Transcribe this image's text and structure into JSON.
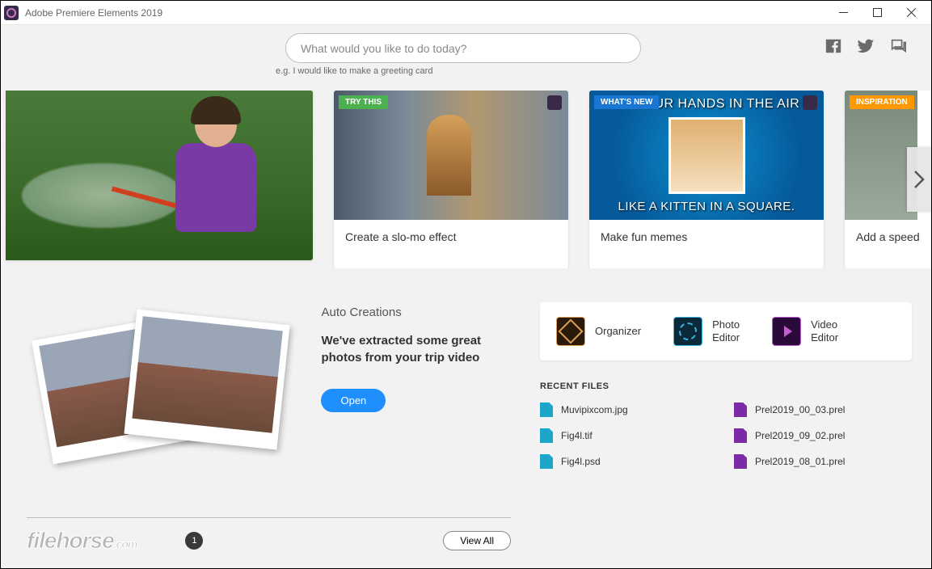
{
  "titlebar": {
    "title": "Adobe Premiere Elements 2019"
  },
  "search": {
    "placeholder": "What would you like to do today?",
    "example": "e.g. I would like to make a greeting card"
  },
  "carousel": {
    "card1": {
      "tag": "TRY THIS",
      "caption": "Create a slo-mo effect"
    },
    "card2": {
      "tag": "WHAT'S NEW",
      "caption": "Make fun memes",
      "meme_top": "UT YOUR HANDS IN THE AIR",
      "meme_bot": "LIKE A KITTEN IN A SQUARE."
    },
    "card3": {
      "tag": "INSPIRATION",
      "caption": "Add a speed"
    }
  },
  "auto": {
    "heading": "Auto Creations",
    "headline": "We've extracted some great photos from your trip video",
    "open": "Open"
  },
  "editors": {
    "organizer": "Organizer",
    "photo": "Photo\nEditor",
    "video": "Video\nEditor"
  },
  "recent": {
    "heading": "RECENT FILES",
    "files_left": [
      "Muvipixcom.jpg",
      "Fig4l.tif",
      "Fig4l.psd"
    ],
    "files_right": [
      "Prel2019_00_03.prel",
      "Prel2019_09_02.prel",
      "Prel2019_08_01.prel"
    ]
  },
  "bottom": {
    "page": "1",
    "viewall": "View All",
    "watermark": "filehorse",
    "watermark_suffix": ".com"
  }
}
